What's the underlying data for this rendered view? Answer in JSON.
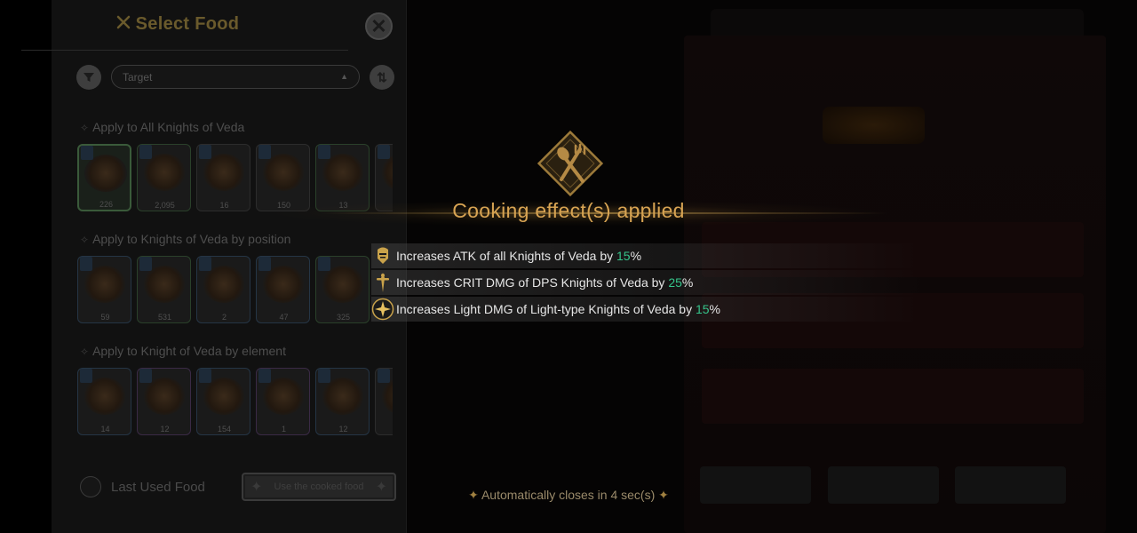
{
  "left_panel": {
    "title": "Select Food",
    "title_icon": "utensils-icon",
    "close_icon": "close-icon",
    "filter_icon": "filter-icon",
    "sort_icon": "sort-icon",
    "select_label": "Target",
    "sections": [
      {
        "heading": "Apply to All Knights of Veda",
        "items": [
          {
            "count": "226",
            "frame": "sel"
          },
          {
            "count": "2,095",
            "frame": "green"
          },
          {
            "count": "16",
            "frame": "plain"
          },
          {
            "count": "150",
            "frame": "plain"
          },
          {
            "count": "13",
            "frame": "green"
          },
          {
            "count": "",
            "frame": "plain"
          }
        ]
      },
      {
        "heading": "Apply to Knights of Veda by position",
        "items": [
          {
            "count": "59",
            "frame": "blue"
          },
          {
            "count": "531",
            "frame": "green"
          },
          {
            "count": "2",
            "frame": "blue"
          },
          {
            "count": "47",
            "frame": "blue"
          },
          {
            "count": "325",
            "frame": "green"
          }
        ]
      },
      {
        "heading": "Apply to Knight of Veda by element",
        "items": [
          {
            "count": "14",
            "frame": "blue"
          },
          {
            "count": "12",
            "frame": "purple"
          },
          {
            "count": "154",
            "frame": "blue"
          },
          {
            "count": "1",
            "frame": "purple"
          },
          {
            "count": "12",
            "frame": "blue"
          },
          {
            "count": "",
            "frame": "plain"
          }
        ]
      }
    ],
    "last_used_label": "Last Used Food",
    "use_button_label": "Use the cooked food"
  },
  "popup": {
    "title": "Cooking effect(s) applied",
    "emblem_icon": "spoon-fork-emblem-icon",
    "effects": [
      {
        "icon": "knight-helmet-icon",
        "prefix": "Increases ATK of all Knights of Veda by ",
        "value": "15",
        "unit": "%"
      },
      {
        "icon": "dagger-icon",
        "prefix": "Increases CRIT DMG of DPS Knights of Veda by ",
        "value": "25",
        "unit": "%"
      },
      {
        "icon": "light-star-icon",
        "prefix": "Increases Light DMG of Light-type Knights of Veda by ",
        "value": "15",
        "unit": "%"
      }
    ],
    "auto_close": "Automatically closes in 4 sec(s)",
    "auto_close_deco": "✦"
  },
  "colors": {
    "title_gold": "#d8a453",
    "percent_green": "#35c48a",
    "effect_text": "#e6e6e6"
  }
}
